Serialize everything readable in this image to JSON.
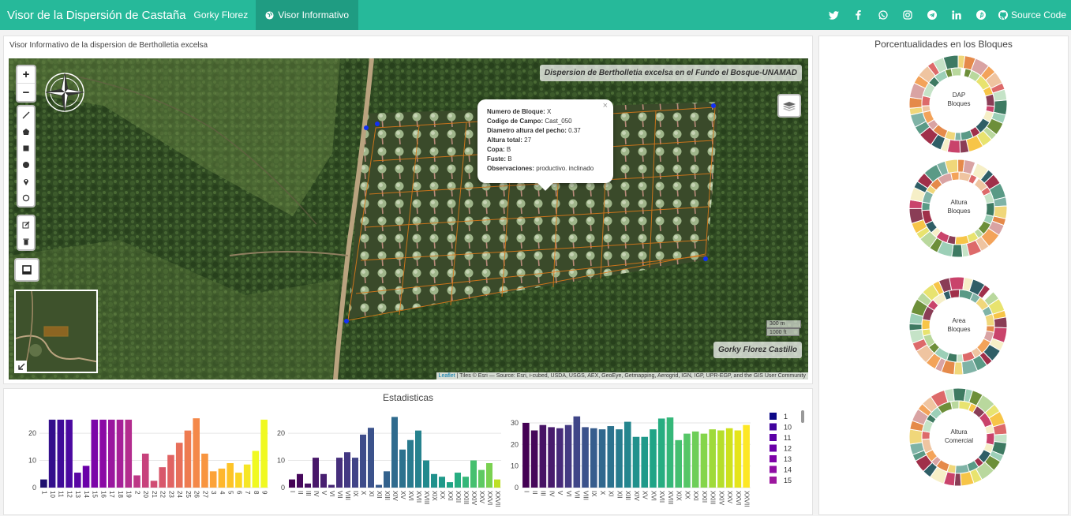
{
  "header": {
    "brand": "Visor de la Dispersión de Castaña",
    "author": "Gorky Florez",
    "active_tab": "Visor Informativo",
    "source_code": "Source Code",
    "social_icons": [
      "twitter-icon",
      "facebook-icon",
      "whatsapp-icon",
      "instagram-icon",
      "telegram-icon",
      "linkedin-icon",
      "pinterest-icon"
    ],
    "bg_color": "#26b99a"
  },
  "map_panel": {
    "title": "Visor Informativo de la dispersion de Bertholletia excelsa",
    "zoom_in": "+",
    "zoom_out": "−",
    "map_title": "Dispersion de Bertholletia excelsa en el Fundo el Bosque-UNAMAD",
    "author_label": "Gorky Florez Castillo",
    "scale_m": "300 m",
    "scale_ft": "1000 ft",
    "attribution_link": "Leaflet",
    "attribution": "| Tiles © Esri — Source: Esri, i-cubed, USDA, USGS, AEX, GeoEye, Getmapping, Aerogrid, IGN, IGP, UPR-EGP, and the GIS User Community",
    "popup": {
      "close": "×",
      "rows": [
        {
          "k": "Numero de Bloque:",
          "v": "X"
        },
        {
          "k": "Codigo de Campo:",
          "v": "Cast_050"
        },
        {
          "k": "Diametro altura del pecho:",
          "v": "0.37"
        },
        {
          "k": "Altura total:",
          "v": "27"
        },
        {
          "k": "Copa:",
          "v": "B"
        },
        {
          "k": "Fuste:",
          "v": "B"
        },
        {
          "k": "Observaciones:",
          "v": "productivo. inclinado"
        }
      ]
    }
  },
  "stats": {
    "title": "Estadisticas",
    "legend": [
      "1",
      "10",
      "11",
      "12",
      "13",
      "14",
      "15"
    ]
  },
  "pie_panel": {
    "title": "Porcentualidades en los Bloques",
    "donuts": [
      {
        "line1": "DAP",
        "line2": "Bloques"
      },
      {
        "line1": "Altura",
        "line2": "Bloques"
      },
      {
        "line1": "Area",
        "line2": "Bloques"
      },
      {
        "line1": "Altura",
        "line2": "Comercial"
      }
    ]
  },
  "chart_data": [
    {
      "type": "bar",
      "categories": [
        "1",
        "10",
        "11",
        "12",
        "13",
        "14",
        "15",
        "16",
        "17",
        "18",
        "19",
        "2",
        "20",
        "21",
        "22",
        "23",
        "24",
        "25",
        "26",
        "27",
        "3",
        "4",
        "5",
        "6",
        "7",
        "8",
        "9"
      ],
      "values": [
        3,
        25,
        25,
        25,
        5.5,
        8,
        25,
        25,
        25,
        25,
        25,
        4.5,
        12.5,
        2.5,
        7.5,
        12,
        16.5,
        21,
        25.5,
        12.5,
        6,
        7,
        9,
        5.5,
        8.5,
        13.5,
        25
      ],
      "ylim": [
        0,
        27
      ],
      "yticks": [
        0,
        10,
        20
      ]
    },
    {
      "type": "bar",
      "categories": [
        "I",
        "II",
        "III",
        "IV",
        "V",
        "VI",
        "VII",
        "VIII",
        "IX",
        "X",
        "XI",
        "XII",
        "XIII",
        "XIV",
        "XV",
        "XVI",
        "XVII",
        "XVIII",
        "XIX",
        "XX",
        "XXI",
        "XXII",
        "XXIII",
        "XXIV",
        "XXV",
        "XXVI",
        "XXVII"
      ],
      "values": [
        3,
        5,
        1.5,
        11,
        5,
        1,
        11,
        13,
        11,
        19.5,
        22,
        1,
        6,
        26,
        14,
        17.5,
        21,
        10,
        5,
        4,
        2,
        5.5,
        4,
        10,
        6.5,
        9,
        3
      ],
      "ylim": [
        0,
        27
      ],
      "yticks": [
        0,
        10,
        20
      ]
    },
    {
      "type": "bar",
      "categories": [
        "I",
        "II",
        "III",
        "IV",
        "V",
        "VI",
        "VII",
        "VIII",
        "IX",
        "X",
        "XI",
        "XII",
        "XIII",
        "XIV",
        "XV",
        "XVI",
        "XVII",
        "XVIII",
        "XIX",
        "XX",
        "XXI",
        "XXII",
        "XXIII",
        "XXIV",
        "XXV",
        "XXVI",
        "XXVII"
      ],
      "values": [
        30,
        26.5,
        29,
        28,
        27.5,
        29,
        33,
        28,
        27.5,
        27,
        28.5,
        27,
        30.5,
        23.5,
        23.5,
        27,
        32,
        32.5,
        22,
        25,
        26,
        25,
        27,
        26.5,
        27.5,
        26.5,
        29
      ],
      "ylim": [
        0,
        34
      ],
      "yticks": [
        0,
        10,
        20,
        30
      ]
    }
  ]
}
